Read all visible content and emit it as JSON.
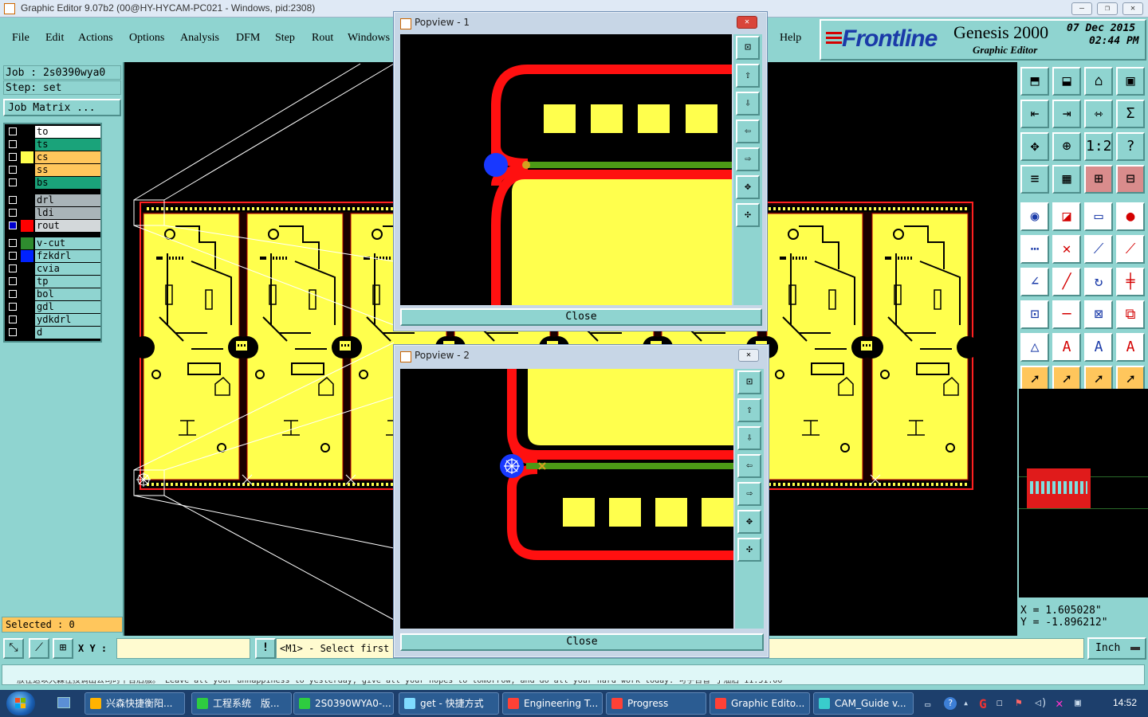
{
  "window": {
    "title": "Graphic Editor 9.07b2 (00@HY-HYCAM-PC021 - Windows, pid:2308)",
    "minimize": "—",
    "restore": "❐",
    "close": "✕"
  },
  "menu": {
    "items": [
      "File",
      "Edit",
      "Actions",
      "Options",
      "Analysis",
      "DFM",
      "Step",
      "Rout",
      "Windows",
      "Help"
    ]
  },
  "logo": {
    "brand": "Frontline",
    "product": "Genesis 2000",
    "subtitle": "Graphic Editor",
    "date": "07 Dec 2015",
    "time": "02:44 PM"
  },
  "job": {
    "job_line": "Job : 2s0390wya0",
    "step_line": "Step: set",
    "matrix_button": "Job Matrix ..."
  },
  "layers": [
    {
      "name": "to",
      "color": "#000000",
      "bg": "#ffffff",
      "box": "#000000"
    },
    {
      "name": "ts",
      "color": "#000000",
      "bg": "#1aa37a",
      "box": "#000000"
    },
    {
      "name": "cs",
      "color": "#ffff4d",
      "bg": "#ffc65c",
      "box": "#000000"
    },
    {
      "name": "ss",
      "color": "#000000",
      "bg": "#ffc65c",
      "box": "#000000"
    },
    {
      "name": "bs",
      "color": "#000000",
      "bg": "#1aa37a",
      "box": "#000000"
    },
    {
      "name": "drl",
      "color": "#000000",
      "bg": "#a9b4b8",
      "box": "#000000"
    },
    {
      "name": "ldi",
      "color": "#000000",
      "bg": "#a9b4b8",
      "box": "#000000"
    },
    {
      "name": "rout",
      "color": "#ff0000",
      "bg": "#d3d8da",
      "box": "#0000cc"
    },
    {
      "name": "v-cut",
      "color": "#2e8b2e",
      "bg": "#8fd4d0",
      "box": "#000000"
    },
    {
      "name": "fzkdrl",
      "color": "#0022ff",
      "bg": "#8fd4d0",
      "box": "#000000"
    },
    {
      "name": "cvia",
      "color": "#000000",
      "bg": "#8fd4d0",
      "box": "#000000"
    },
    {
      "name": "tp",
      "color": "#000000",
      "bg": "#8fd4d0",
      "box": "#000000"
    },
    {
      "name": "bol",
      "color": "#000000",
      "bg": "#8fd4d0",
      "box": "#000000"
    },
    {
      "name": "gdl",
      "color": "#000000",
      "bg": "#8fd4d0",
      "box": "#000000"
    },
    {
      "name": "ydkdrl",
      "color": "#000000",
      "bg": "#8fd4d0",
      "box": "#000000"
    },
    {
      "name": "d",
      "color": "#000000",
      "bg": "#8fd4d0",
      "box": "#000000"
    }
  ],
  "selected": {
    "label": "Selected : 0"
  },
  "bottom": {
    "xy_label": "X Y :",
    "prompt": "<M1> - Select first",
    "unit": "Inch",
    "warn_icon": "!"
  },
  "coords": {
    "x": "X = 1.605028\"",
    "y": "Y = -1.896212\""
  },
  "popup1": {
    "title": "Popview - 1",
    "close": "Close",
    "close_x": "✕"
  },
  "popup2": {
    "title": "Popview - 2",
    "close": "Close",
    "close_x": "✕"
  },
  "status": {
    "text": "放在这以大森性技调出公司时平台后服。   Leave all your unhappiness to yesterday, give all your hopes to tomorrow, and do all your hard work today.   可手台智   丁油后   11:51:00"
  },
  "taskbar": {
    "items": [
      {
        "label": "兴森快捷衡阳...",
        "color": "#ffb300"
      },
      {
        "label": "工程系统　版...",
        "color": "#2ecc40"
      },
      {
        "label": "2S0390WYA0-...",
        "color": "#2ecc40"
      },
      {
        "label": "get - 快捷方式",
        "color": "#7fdbff"
      },
      {
        "label": "Engineering T...",
        "color": "#ff4136"
      },
      {
        "label": "Progress",
        "color": "#ff4136"
      },
      {
        "label": "Graphic Edito...",
        "color": "#ff4136"
      },
      {
        "label": "CAM_Guide v...",
        "color": "#39cccc"
      }
    ],
    "clock": "14:52"
  }
}
